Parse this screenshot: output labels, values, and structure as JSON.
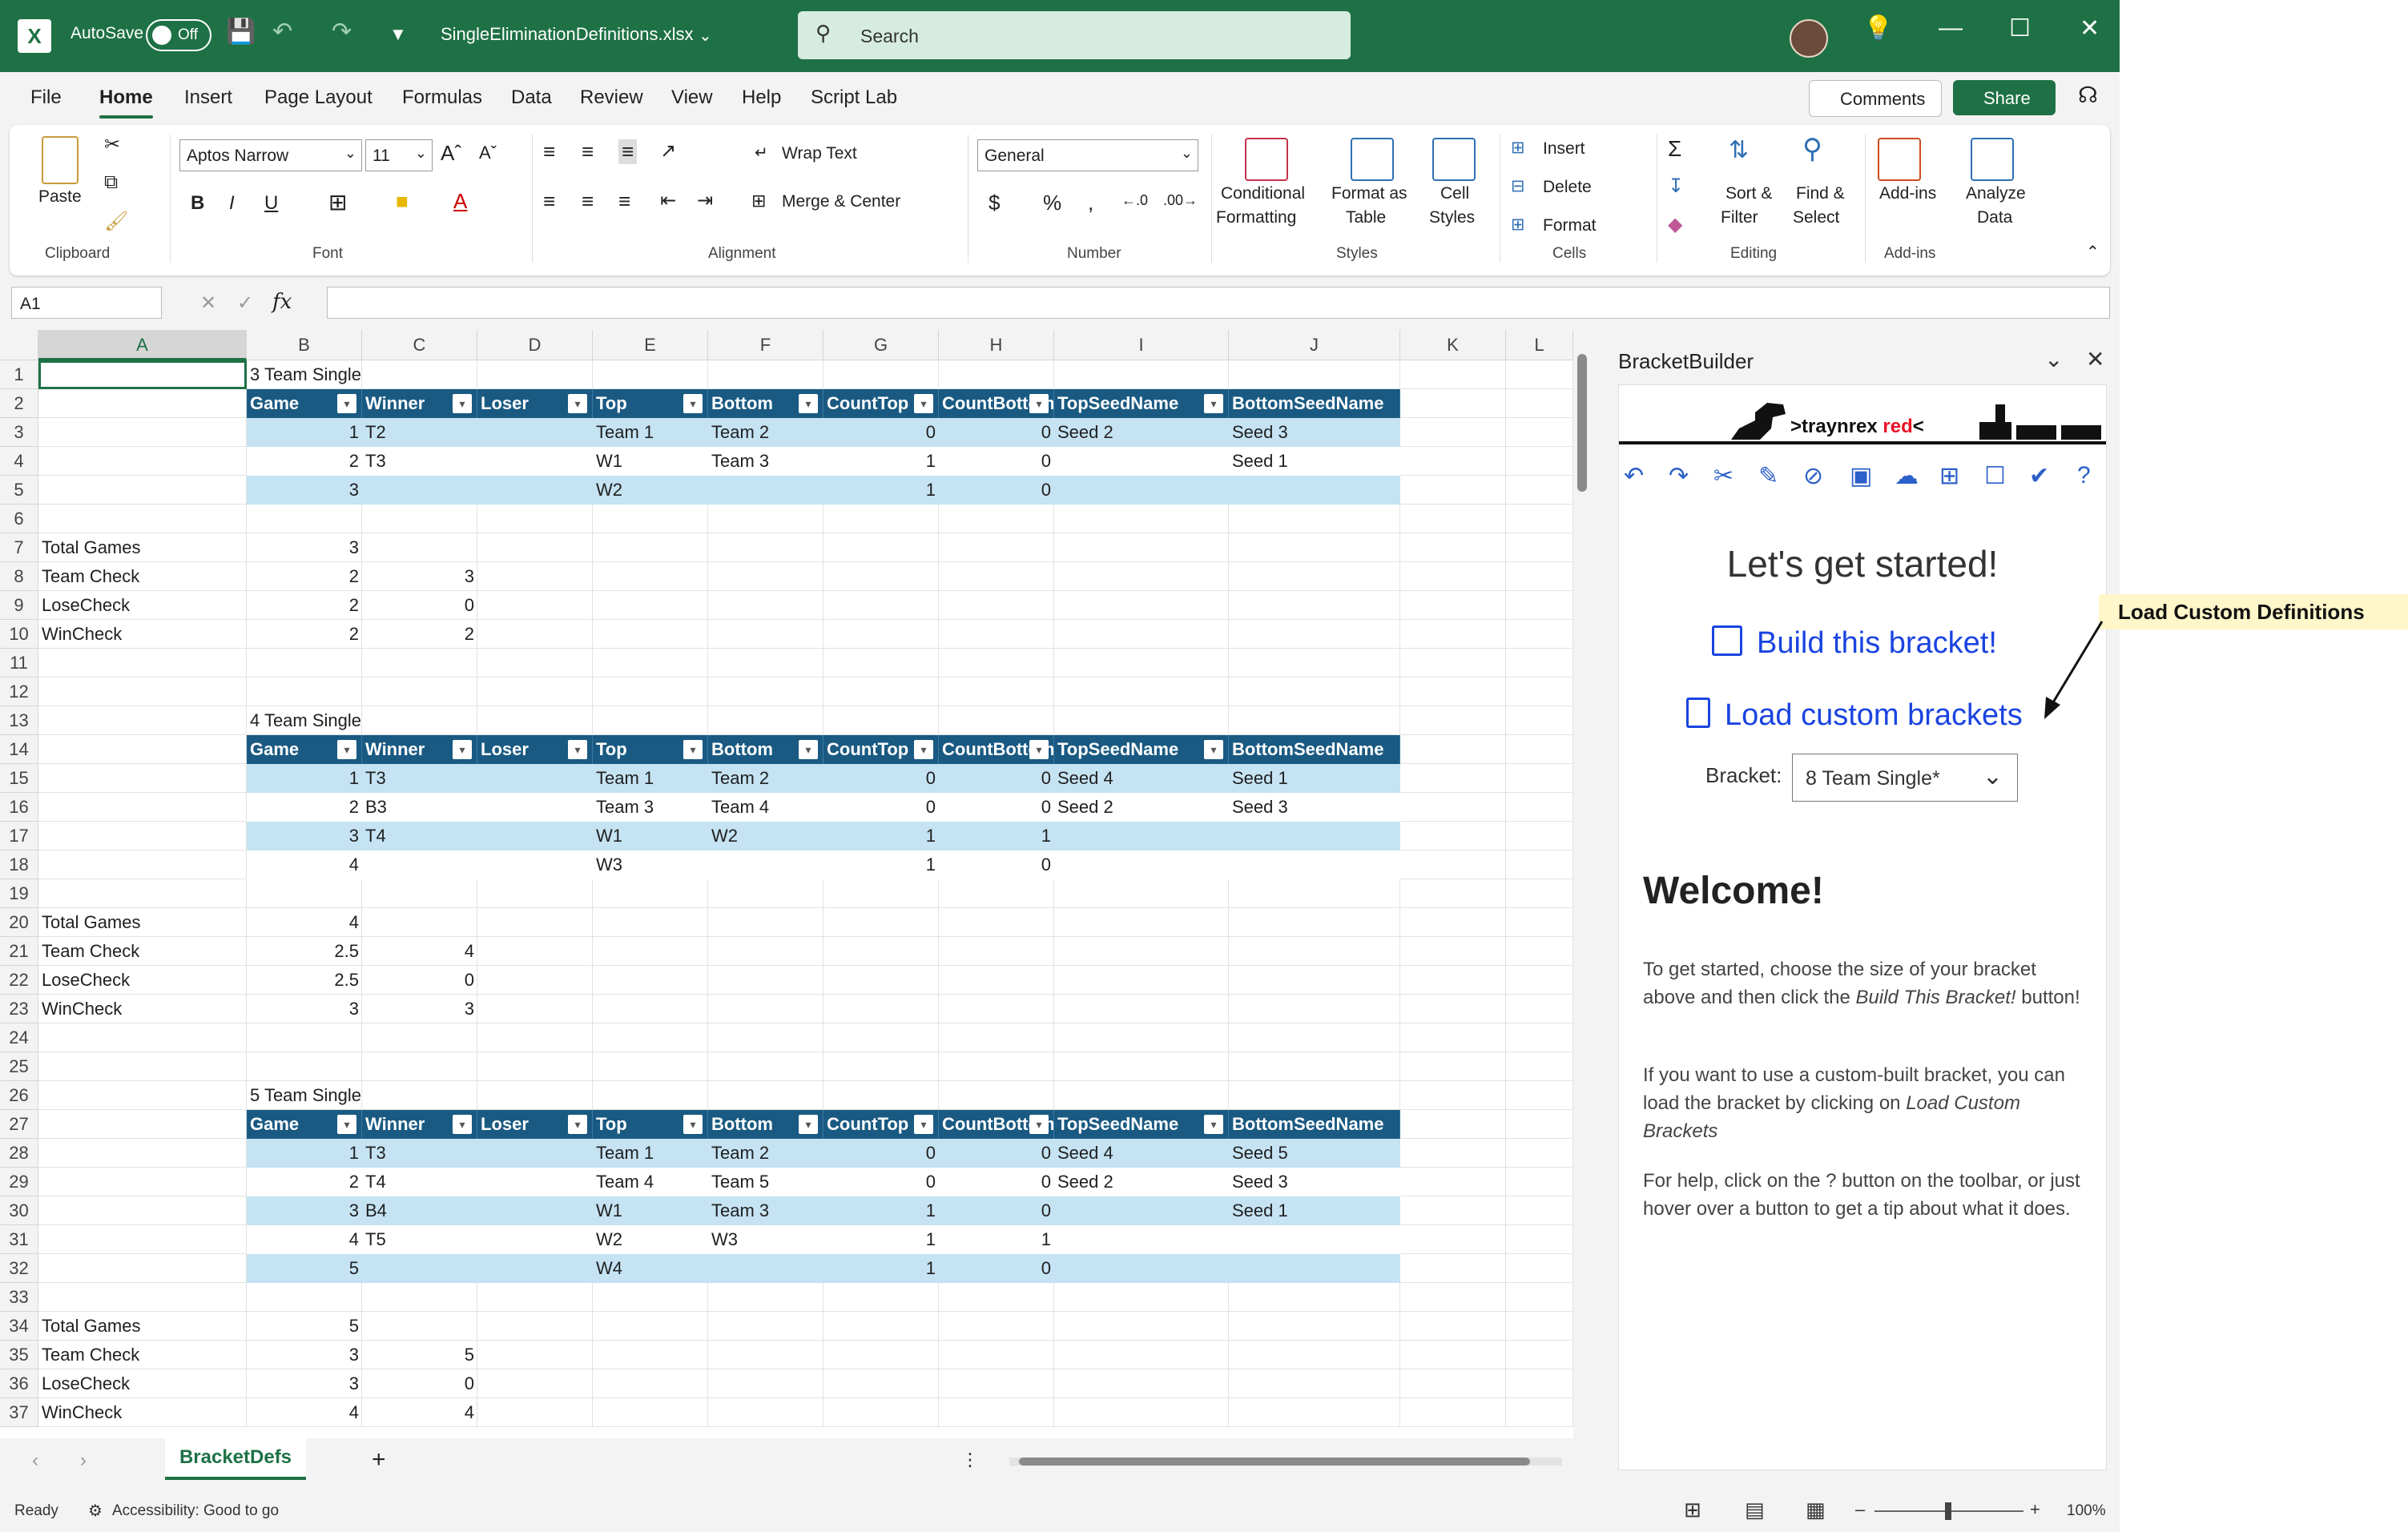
{
  "app": {
    "autosave_label": "AutoSave",
    "autosave_state": "Off",
    "filename": "SingleEliminationDefinitions.xlsx",
    "search_placeholder": "Search",
    "brand_color": "#1e7145"
  },
  "ribbon_tabs": [
    "File",
    "Home",
    "Insert",
    "Page Layout",
    "Formulas",
    "Data",
    "Review",
    "View",
    "Help",
    "Script Lab"
  ],
  "comments_label": "Comments",
  "share_label": "Share",
  "ribbon": {
    "paste": "Paste",
    "clipboard": "Clipboard",
    "font_name": "Aptos Narrow",
    "font_size": "11",
    "font": "Font",
    "wrap_text": "Wrap Text",
    "merge_center": "Merge & Center",
    "alignment": "Alignment",
    "number_format": "General",
    "number": "Number",
    "conditional_formatting_1": "Conditional",
    "conditional_formatting_2": "Formatting",
    "format_as_table_1": "Format as",
    "format_as_table_2": "Table",
    "cell_styles_1": "Cell",
    "cell_styles_2": "Styles",
    "styles": "Styles",
    "insert": "Insert",
    "delete": "Delete",
    "format": "Format",
    "cells": "Cells",
    "sort_filter_1": "Sort &",
    "sort_filter_2": "Filter",
    "find_select_1": "Find &",
    "find_select_2": "Select",
    "editing": "Editing",
    "addins": "Add-ins",
    "addins_group": "Add-ins",
    "analyze_1": "Analyze",
    "analyze_2": "Data"
  },
  "formula_bar": {
    "name_box": "A1",
    "fx": "fx"
  },
  "columns": [
    "A",
    "B",
    "C",
    "D",
    "E",
    "F",
    "G",
    "H",
    "I",
    "J",
    "K",
    "L"
  ],
  "rows": [
    "1",
    "2",
    "3",
    "4",
    "5",
    "6",
    "7",
    "8",
    "9",
    "10",
    "11",
    "12",
    "13",
    "14",
    "15",
    "16",
    "17",
    "18",
    "19",
    "20",
    "21",
    "22",
    "23",
    "24",
    "25",
    "26",
    "27",
    "28",
    "29",
    "30",
    "31",
    "32",
    "33",
    "34",
    "35",
    "36",
    "37"
  ],
  "table_headers": [
    "Game",
    "Winner",
    "Loser",
    "Top",
    "Bottom",
    "CountTop",
    "CountBottom",
    "TopSeedName",
    "BottomSeedName"
  ],
  "sections": [
    {
      "title": "3 Team Single",
      "rows": [
        [
          "1",
          "T2",
          "",
          "Team 1",
          "Team 2",
          "0",
          "0",
          "Seed 2",
          "Seed 3"
        ],
        [
          "2",
          "T3",
          "",
          "W1",
          "Team 3",
          "1",
          "0",
          "",
          "Seed 1"
        ],
        [
          "3",
          "",
          "",
          "W2",
          "",
          "1",
          "0",
          "",
          ""
        ]
      ],
      "summary": [
        [
          "Total Games",
          "3",
          ""
        ],
        [
          "Team Check",
          "2",
          "3"
        ],
        [
          "LoseCheck",
          "2",
          "0"
        ],
        [
          "WinCheck",
          "2",
          "2"
        ]
      ]
    },
    {
      "title": "4 Team Single",
      "rows": [
        [
          "1",
          "T3",
          "",
          "Team 1",
          "Team 2",
          "0",
          "0",
          "Seed 4",
          "Seed 1"
        ],
        [
          "2",
          "B3",
          "",
          "Team 3",
          "Team 4",
          "0",
          "0",
          "Seed 2",
          "Seed 3"
        ],
        [
          "3",
          "T4",
          "",
          "W1",
          "W2",
          "1",
          "1",
          "",
          ""
        ],
        [
          "4",
          "",
          "",
          "W3",
          "",
          "1",
          "0",
          "",
          ""
        ]
      ],
      "summary": [
        [
          "Total Games",
          "4",
          ""
        ],
        [
          "Team Check",
          "2.5",
          "4"
        ],
        [
          "LoseCheck",
          "2.5",
          "0"
        ],
        [
          "WinCheck",
          "3",
          "3"
        ]
      ]
    },
    {
      "title": "5 Team Single",
      "rows": [
        [
          "1",
          "T3",
          "",
          "Team 1",
          "Team 2",
          "0",
          "0",
          "Seed 4",
          "Seed 5"
        ],
        [
          "2",
          "T4",
          "",
          "Team 4",
          "Team 5",
          "0",
          "0",
          "Seed 2",
          "Seed 3"
        ],
        [
          "3",
          "B4",
          "",
          "W1",
          "Team 3",
          "1",
          "0",
          "",
          "Seed 1"
        ],
        [
          "4",
          "T5",
          "",
          "W2",
          "W3",
          "1",
          "1",
          "",
          ""
        ],
        [
          "5",
          "",
          "",
          "W4",
          "",
          "1",
          "0",
          "",
          ""
        ]
      ],
      "summary": [
        [
          "Total Games",
          "5",
          ""
        ],
        [
          "Team Check",
          "3",
          "5"
        ],
        [
          "LoseCheck",
          "3",
          "0"
        ],
        [
          "WinCheck",
          "4",
          "4"
        ]
      ]
    }
  ],
  "sheet_tab": "BracketDefs",
  "status": {
    "ready": "Ready",
    "accessibility": "Accessibility: Good to go",
    "zoom": "100%"
  },
  "pane": {
    "title": "BracketBuilder",
    "brand_prefix": ">traynrex ",
    "brand_red": "red",
    "brand_suffix": "<",
    "heading": "Let's get started!",
    "build_link": "Build this bracket!",
    "load_link": "Load custom brackets",
    "bracket_label": "Bracket:",
    "bracket_value": "8 Team Single*",
    "welcome": "Welcome!",
    "p1_a": "To get started, choose the size of your bracket above and then click the ",
    "p1_em": "Build This Bracket!",
    "p1_b": " button!",
    "p2_a": "If you want to use a custom-built bracket, you can load the bracket by clicking on ",
    "p2_em": "Load Custom Brackets",
    "p3": "For help, click on the ? button on the toolbar, or just hover over a button to get a tip about what it does."
  },
  "annotation": "Load Custom Definitions"
}
